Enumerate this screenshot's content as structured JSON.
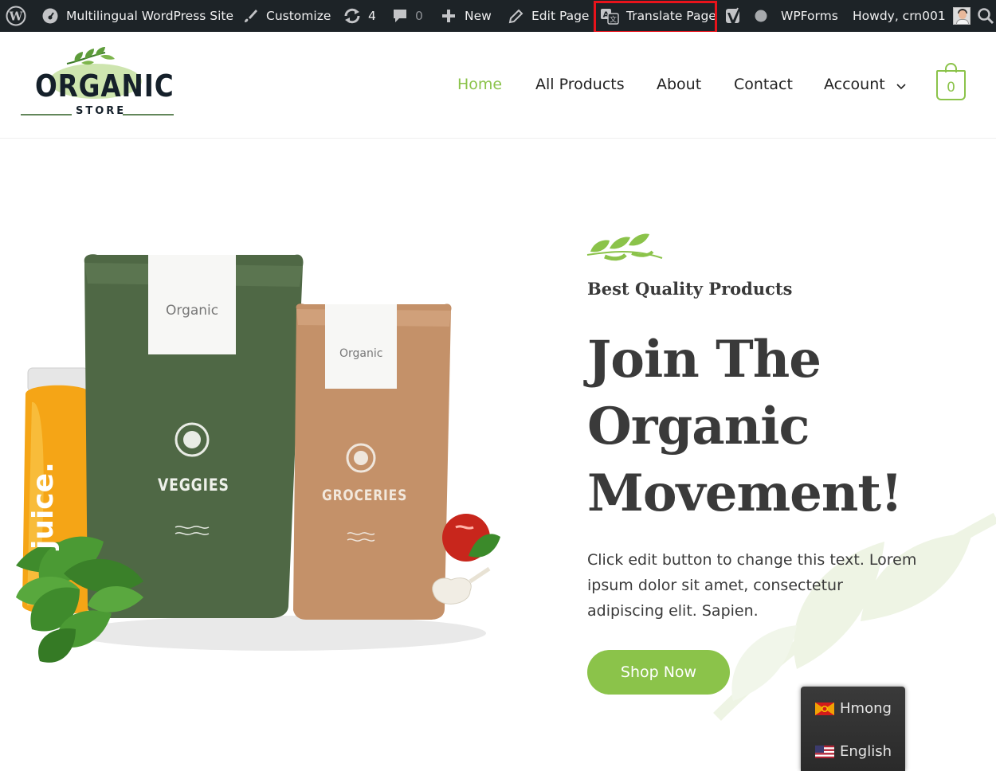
{
  "admin_bar": {
    "site_name": "Multilingual WordPress Site",
    "customize": "Customize",
    "updates_count": "4",
    "comments_count": "0",
    "new": "New",
    "edit_page": "Edit Page",
    "translate_page": "Translate Page",
    "wpforms": "WPForms",
    "howdy": "Howdy, crn001"
  },
  "header": {
    "logo_main": "ORGANIC",
    "logo_sub": "STORE",
    "nav": [
      "Home",
      "All Products",
      "About",
      "Contact",
      "Account"
    ],
    "cart_count": "0"
  },
  "hero": {
    "eyebrow": "Best Quality Products",
    "title_line1": "Join The",
    "title_line2": "Organic",
    "title_line3": "Movement!",
    "text": "Click edit button to change this text. Lorem ipsum dolor sit amet, consectetur adipiscing elit. Sapien.",
    "button": "Shop Now",
    "product_labels": {
      "bag_brand": "Organic",
      "bag_brand_2": "Organic",
      "bag1": "VEGGIES",
      "bag2": "GROCERIES",
      "bottle": "juice."
    }
  },
  "languages": [
    "Hmong",
    "English"
  ],
  "colors": {
    "accent": "#8bc34a",
    "adminbar": "#1d2327",
    "highlight": "#e8131b",
    "text": "#3a3a3a"
  }
}
